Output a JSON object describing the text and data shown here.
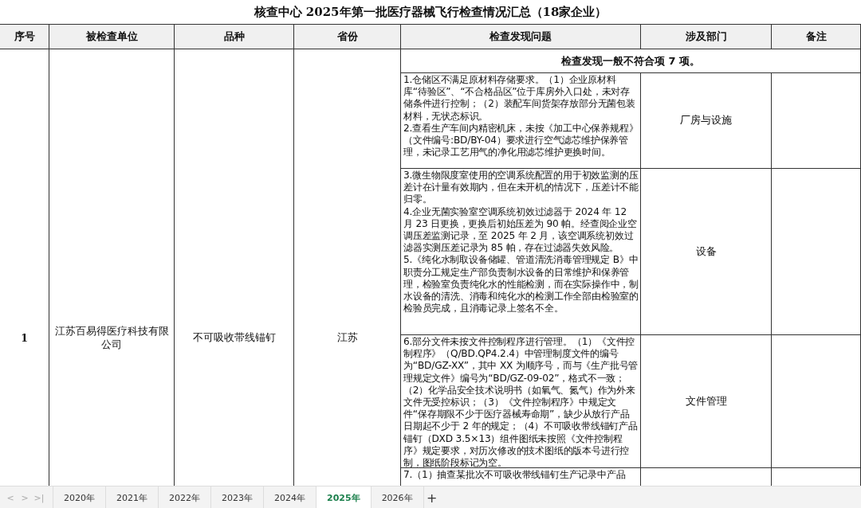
{
  "title": "核查中心 2025年第一批医疗器械飞行检查情况汇总（18家企业）",
  "columns": [
    "序号",
    "被检查单位",
    "品种",
    "省份",
    "检查发现问题",
    "涉及部门",
    "备注"
  ],
  "rows": [
    {
      "seq": "1",
      "unit": "江苏百易得医疗科技有限公司",
      "product": "不可吸收带线锚钉",
      "province": "江苏",
      "summary": "检查发现一般不符合项 7 项。",
      "groups": [
        {
          "findings": [
            "1.仓储区不满足原材料存储要求。（1）企业原材料库“待验区”、“不合格品区”位于库房外入口处，未对存储条件进行控制；（2）装配车间货架存放部分无菌包装材料，无状态标识。",
            "2.查看生产车间内精密机床，未按《加工中心保养规程》（文件编号:BD/BY-04）要求进行空气滤芯维护保养管理，未记录工艺用气的净化用滤芯维护更换时间。"
          ],
          "department": "厂房与设施"
        },
        {
          "findings": [
            "3.微生物限度室使用的空调系统配置的用于初效监测的压差计在计量有效期内，但在未开机的情况下，压差计不能归零。",
            "4.企业无菌实验室空调系统初效过滤器于 2024 年 12 月 23 日更换，更换后初始压差为 90 帕。经查阅企业空调压差监测记录，至 2025 年 2 月，该空调系统初效过滤器实测压差记录为 85 帕，存在过滤器失效风险。",
            "5.《纯化水制取设备储罐、管道清洗消毒管理规定 B》中职责分工规定生产部负责制水设备的日常维护和保养管理，检验室负责纯化水的性能检测，而在实际操作中，制水设备的清洗、消毒和纯化水的检测工作全部由检验室的检验员完成，且消毒记录上签名不全。"
          ],
          "department": "设备"
        },
        {
          "findings": [
            "6.部分文件未按文件控制程序进行管理。（1）《文件控制程序》（Q/BD.QP4.2.4）中管理制度文件的编号为“BD/GZ-XX”，其中 XX 为顺序号，而与《生产批号管理规定文件》编号为“BD/GZ-09-02”，格式不一致；（2）化学品安全技术说明书（如氧气、氮气）作为外来文件无受控标识；（3）《文件控制程序》中规定文件“保存期限不少于医疗器械寿命期”，缺少从放行产品日期起不少于 2 年的规定；（4）不可吸收带线锚钉产品锚钉（DXD 3.5×13）组件图纸未按照《文件控制程序》规定要求，对历次修改的技术图纸的版本号进行控制，图纸阶段标记为空。"
          ],
          "department": "文件管理"
        },
        {
          "findings": [
            "7.（1）抽查某批次不可吸收带线锚钉生产记录中产品"
          ]
        }
      ]
    }
  ],
  "sheet_nav": [
    "<",
    ">",
    ">|"
  ],
  "sheet_tabs": [
    {
      "label": "2020年",
      "selected": false
    },
    {
      "label": "2021年",
      "selected": false
    },
    {
      "label": "2022年",
      "selected": false
    },
    {
      "label": "2023年",
      "selected": false
    },
    {
      "label": "2024年",
      "selected": false
    },
    {
      "label": "2025年",
      "selected": true
    },
    {
      "label": "2026年",
      "selected": false
    }
  ],
  "add_sheet": "+"
}
